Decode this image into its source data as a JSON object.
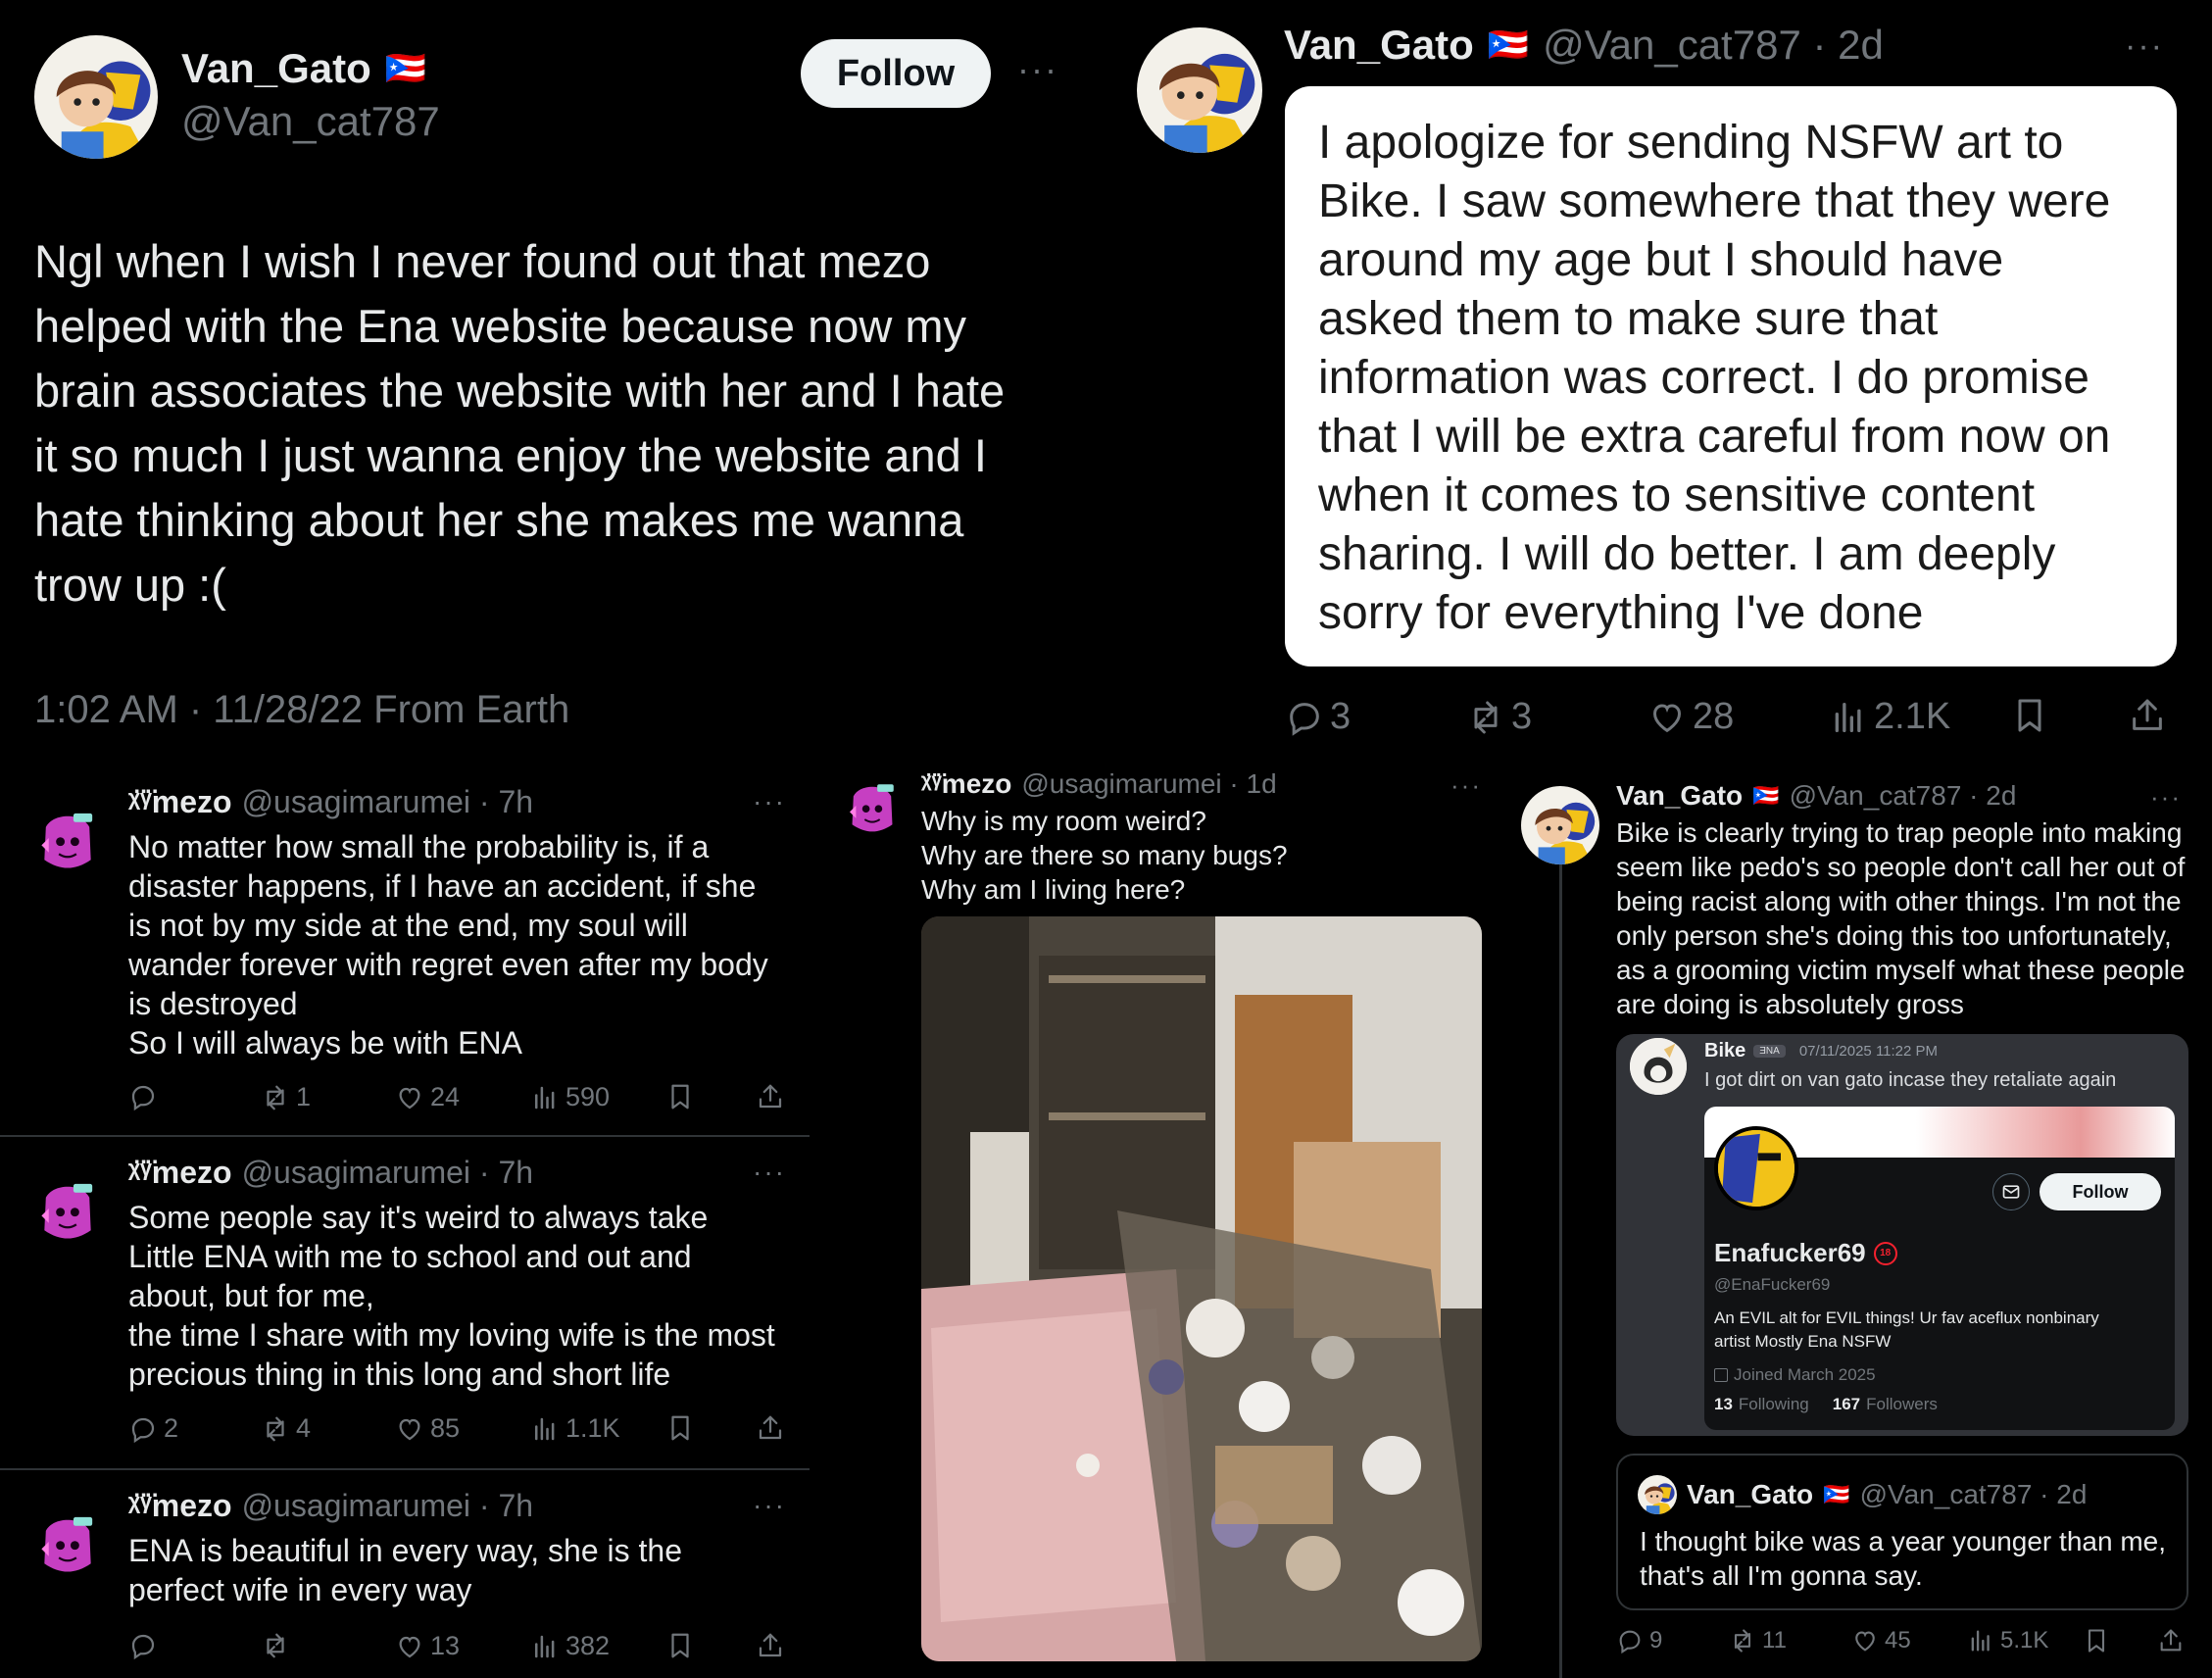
{
  "tweet_a": {
    "name": "Van_Gato",
    "flag": "🇵🇷",
    "handle": "@Van_cat787",
    "follow_label": "Follow",
    "more": "···",
    "lines": [
      "Ngl when I wish I never found out that mezo",
      "helped with the Ena website because now my",
      "brain associates the website with her and I hate",
      "it so much I just wanna enjoy the website and I",
      "hate thinking about her she makes me wanna",
      "trow up :("
    ],
    "meta": "1:02 AM · 11/28/22 From Earth"
  },
  "tweet_b": {
    "name": "Van_Gato",
    "flag": "🇵🇷",
    "handle": "@Van_cat787 · 2d",
    "more": "···",
    "lines": [
      "I apologize for sending NSFW art to",
      "Bike. I saw somewhere that they were",
      "around my age but I should have",
      "asked them to make sure that",
      "information was correct. I do promise",
      "that I will be extra careful from now on",
      "when it comes to sensitive content",
      "sharing. I will do better. I am deeply",
      "sorry for everything I've done"
    ],
    "replies": "3",
    "reposts": "3",
    "likes": "28",
    "views": "2.1K"
  },
  "mezo_posts": [
    {
      "name": "ᵡ̈ᵞ̈mezo",
      "handle": "@usagimarumei · 7h",
      "lines": [
        "No matter how small the probability is, if a",
        "disaster happens, if I have an accident, if she",
        "is not by my side at the end, my soul will",
        "wander forever with regret even after my body",
        "is destroyed",
        "So I will always be with ENA"
      ],
      "replies": "",
      "reposts": "1",
      "likes": "24",
      "views": "590"
    },
    {
      "name": "ᵡ̈ᵞ̈mezo",
      "handle": "@usagimarumei · 7h",
      "lines": [
        "Some people say it's weird to always take",
        "Little ENA with me to school and out and",
        "about, but for me,",
        "the time I share with my loving wife is the most",
        "precious thing in this long and short life"
      ],
      "replies": "2",
      "reposts": "4",
      "likes": "85",
      "views": "1.1K"
    },
    {
      "name": "ᵡ̈ᵞ̈mezo",
      "handle": "@usagimarumei · 7h",
      "lines": [
        "ENA is beautiful in every way, she is the",
        "perfect wife in every way"
      ],
      "replies": "",
      "reposts": "",
      "likes": "13",
      "views": "382"
    }
  ],
  "room_post": {
    "name": "ᵡ̈ᵞ̈mezo",
    "handle": "@usagimarumei · 1d",
    "more": "···",
    "lines": [
      "Why is my room weird?",
      "Why are there so many bugs?",
      "Why am I living here?"
    ]
  },
  "bike_post": {
    "name": "Van_Gato",
    "flag": "🇵🇷",
    "handle": "@Van_cat787 · 2d",
    "more": "···",
    "lines": [
      "Bike is clearly trying to trap people into making",
      "seem like pedo's so people don't call her out of",
      "being racist along with other things. I'm not the",
      "only person she's doing this too unfortunately,",
      "as a grooming victim myself what these people",
      "are doing is absolutely gross"
    ],
    "discord": {
      "name": "Bike",
      "tag": "ƎNA",
      "time": "07/11/2025 11:22 PM",
      "message": "I got dirt on van gato incase they retaliate again",
      "profile": {
        "name": "Enafucker69",
        "handle": "@EnaFucker69",
        "bio_lines": [
          "An EVIL alt for EVIL things! Ur fav aceflux nonbinary",
          "artist Mostly Ena NSFW"
        ],
        "joined": "Joined March 2025",
        "following_count": "13",
        "following_label": "Following",
        "followers_count": "167",
        "followers_label": "Followers",
        "follow_label": "Follow"
      }
    },
    "quote": {
      "name": "Van_Gato",
      "flag": "🇵🇷",
      "handle": "@Van_cat787 · 2d",
      "lines": [
        "I thought bike was a year younger than me,",
        "that's all I'm gonna say."
      ]
    },
    "replies": "9",
    "reposts": "11",
    "likes": "45",
    "views": "5.1K"
  },
  "colors": {
    "background": "#000000",
    "text": "#e7e9ea",
    "muted": "#71767b",
    "border": "#2f3336",
    "follow_bg": "#eff3f4"
  }
}
